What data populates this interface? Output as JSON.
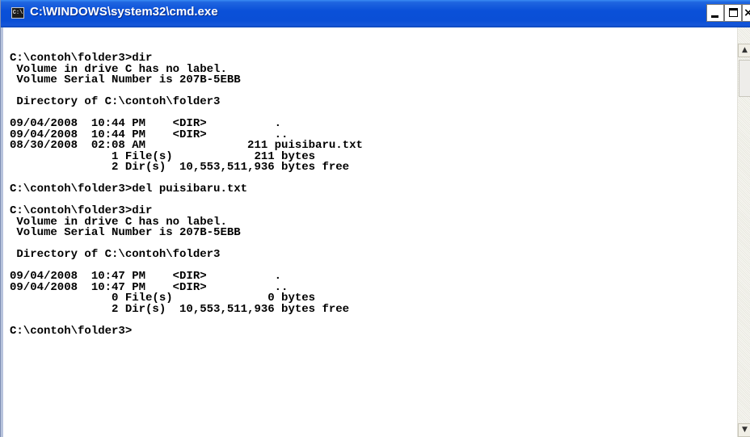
{
  "window": {
    "title": "C:\\WINDOWS\\system32\\cmd.exe",
    "icon": "console-icon",
    "icon_text": "C:\\",
    "controls": {
      "minimize": "_",
      "maximize": "□",
      "close": "×"
    }
  },
  "console": {
    "lines": [
      "C:\\contoh\\folder3>dir",
      " Volume in drive C has no label.",
      " Volume Serial Number is 207B-5EBB",
      "",
      " Directory of C:\\contoh\\folder3",
      "",
      "09/04/2008  10:44 PM    <DIR>          .",
      "09/04/2008  10:44 PM    <DIR>          ..",
      "08/30/2008  02:08 AM               211 puisibaru.txt",
      "               1 File(s)            211 bytes",
      "               2 Dir(s)  10,553,511,936 bytes free",
      "",
      "C:\\contoh\\folder3>del puisibaru.txt",
      "",
      "C:\\contoh\\folder3>dir",
      " Volume in drive C has no label.",
      " Volume Serial Number is 207B-5EBB",
      "",
      " Directory of C:\\contoh\\folder3",
      "",
      "09/04/2008  10:47 PM    <DIR>          .",
      "09/04/2008  10:47 PM    <DIR>          ..",
      "               0 File(s)              0 bytes",
      "               2 Dir(s)  10,553,511,936 bytes free",
      "",
      "C:\\contoh\\folder3>"
    ]
  },
  "scrollbar": {
    "up_arrow": "▲",
    "down_arrow": "▼"
  }
}
